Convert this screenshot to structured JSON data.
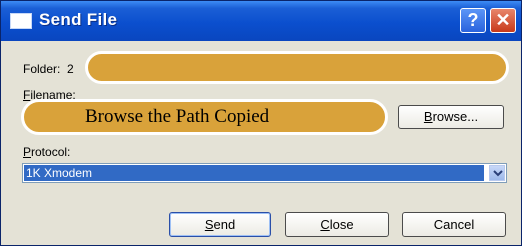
{
  "window": {
    "title": "Send File",
    "help_glyph": "?",
    "close_glyph": "✕"
  },
  "folder": {
    "label": "Folder:",
    "value_fragment": "2"
  },
  "filename": {
    "label_first": "F",
    "label_rest": "ilename:",
    "annotation": "Browse the Path Copied"
  },
  "browse_button": {
    "label_first": "B",
    "label_rest": "rowse..."
  },
  "protocol": {
    "label_first": "P",
    "label_rest": "rotocol:",
    "selected": "1K Xmodem"
  },
  "buttons": {
    "send_first": "S",
    "send_rest": "end",
    "close_first": "C",
    "close_rest": "lose",
    "cancel": "Cancel"
  },
  "colors": {
    "titlebar": "#0b4fce",
    "annotation_fill": "#d9a23a",
    "dialog_bg": "#e4e2d6",
    "selection": "#316ac5"
  },
  "icons": {
    "title": "window-icon",
    "help": "help-icon",
    "close": "close-icon",
    "dropdown": "chevron-down-icon"
  }
}
